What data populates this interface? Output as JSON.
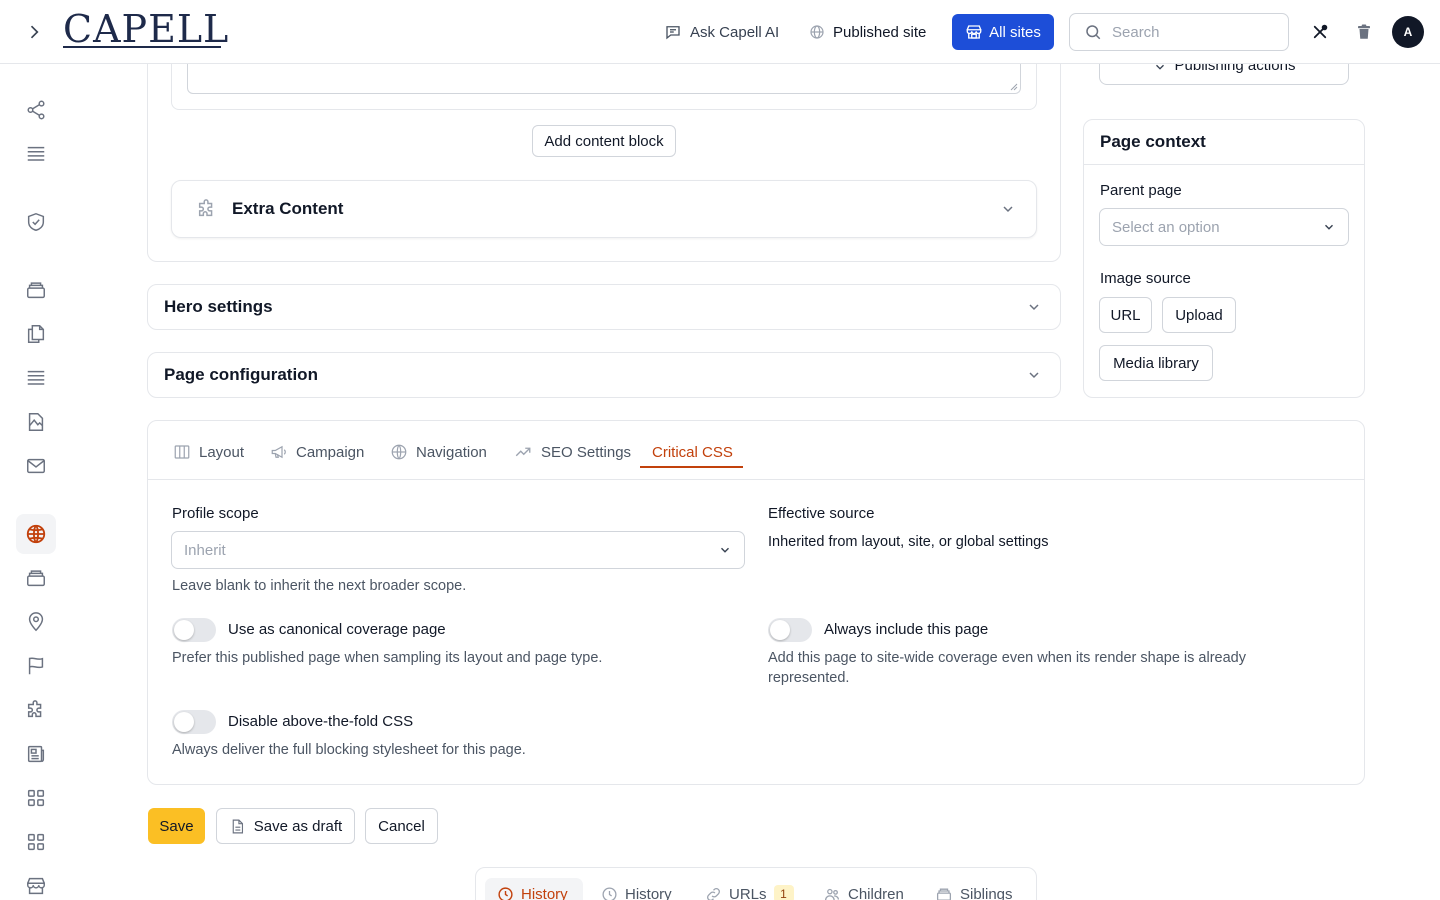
{
  "topbar": {
    "logo_text": "CAPELL",
    "ask_ai_label": "Ask Capell AI",
    "published_site_label": "Published site",
    "all_sites_label": "All sites",
    "search_placeholder": "Search",
    "avatar_initial": "A",
    "accent_color": "#1d4ed8"
  },
  "sidebar": {
    "icons": [
      "share-icon",
      "list-icon",
      "shield-check-icon",
      "layers-icon",
      "copy-icon",
      "list-icon",
      "file-image-icon",
      "mail-icon",
      "globe-icon",
      "layers-icon",
      "map-pin-icon",
      "flag-icon",
      "puzzle-icon",
      "newspaper-icon",
      "grid-icon",
      "grid-icon",
      "store-icon"
    ],
    "active_icon": "globe-icon"
  },
  "content": {
    "add_block_label": "Add content block",
    "extra_content_title": "Extra Content",
    "hero_settings_title": "Hero settings",
    "page_configuration_title": "Page configuration"
  },
  "right_panel": {
    "publishing_actions_label": "Publishing actions",
    "page_context_title": "Page context",
    "parent_page_label": "Parent page",
    "parent_page_placeholder": "Select an option",
    "image_source_label": "Image source",
    "image_source_options": [
      "URL",
      "Upload",
      "Media library"
    ]
  },
  "tabs": [
    {
      "label": "Layout",
      "icon": "columns-icon"
    },
    {
      "label": "Campaign",
      "icon": "megaphone-icon"
    },
    {
      "label": "Navigation",
      "icon": "globe-icon"
    },
    {
      "label": "SEO Settings",
      "icon": "trending-up-icon"
    },
    {
      "label": "Critical CSS",
      "icon": ""
    }
  ],
  "active_tab": "Critical CSS",
  "critical_css": {
    "profile_scope_label": "Profile scope",
    "profile_scope_value": "Inherit",
    "profile_scope_help": "Leave blank to inherit the next broader scope.",
    "effective_source_label": "Effective source",
    "effective_source_value": "Inherited from layout, site, or global settings",
    "canonical_label": "Use as canonical coverage page",
    "canonical_help": "Prefer this published page when sampling its layout and page type.",
    "canonical_on": false,
    "always_include_label": "Always include this page",
    "always_include_help": "Add this page to site-wide coverage even when its render shape is already represented.",
    "always_include_on": false,
    "disable_fold_label": "Disable above-the-fold CSS",
    "disable_fold_help": "Always deliver the full blocking stylesheet for this page.",
    "disable_fold_on": false
  },
  "actions": {
    "save_label": "Save",
    "save_draft_label": "Save as draft",
    "cancel_label": "Cancel"
  },
  "bottom_tabs": [
    {
      "label": "History",
      "icon": "clock-icon",
      "active": true
    },
    {
      "label": "History",
      "icon": "clock-icon",
      "active": false
    },
    {
      "label": "URLs",
      "icon": "link-icon",
      "badge": "1"
    },
    {
      "label": "Children",
      "icon": "users-icon"
    },
    {
      "label": "Siblings",
      "icon": "layers-icon"
    }
  ]
}
